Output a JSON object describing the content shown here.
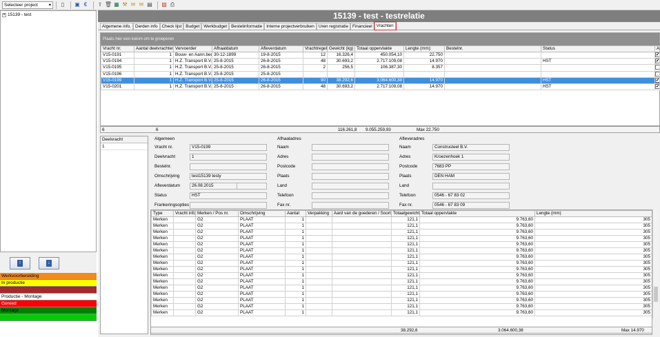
{
  "toolbar": {
    "project_select": "Selecteer project",
    "icons": [
      "new-doc-icon",
      "save-icon",
      "euro-icon",
      "export-icon",
      "trash-icon",
      "excel-icon",
      "tools-icon",
      "mail-icon",
      "email-icon",
      "table-icon",
      "pdf-icon",
      "print-icon"
    ]
  },
  "tree": {
    "items": [
      {
        "label": "15139 - test"
      }
    ]
  },
  "legend": [
    {
      "label": "Werkvoorbereiding",
      "color": "#f28a1c"
    },
    {
      "label": "In productie",
      "color": "#ffff00"
    },
    {
      "label": "",
      "color": "#a52a2a"
    },
    {
      "label": "Productie - Montage",
      "color": "#ffffff"
    },
    {
      "label": "Gereed",
      "color": "#ff0000"
    },
    {
      "label": "Montage",
      "color": "#008000"
    },
    {
      "label": "",
      "color": "#00cc00"
    }
  ],
  "header": {
    "title": "15139 - test - testrelatie"
  },
  "tabs": [
    {
      "label": "Algemene info."
    },
    {
      "label": "Derden info"
    },
    {
      "label": "Check lijst"
    },
    {
      "label": "Budget"
    },
    {
      "label": "Werkbudget"
    },
    {
      "label": "Bestelinformatie"
    },
    {
      "label": "Interne projectverbruiken"
    },
    {
      "label": "Uren registratie"
    },
    {
      "label": "Financieel"
    },
    {
      "label": "Vrachten",
      "active": true
    }
  ],
  "vrachten": {
    "group_hint": "Plaats hier een kolom om te groeperen",
    "columns": [
      "Vracht nr.",
      "Aantal deelvrachten",
      "Vervoerder",
      "Afhaaldatum",
      "Afleverdatum",
      "Vrachtregels",
      "Gewicht (kg)",
      "Totaal oppervlakte",
      "Lengte (mm):",
      "Bestelnr.",
      "Status",
      "Act"
    ],
    "rows": [
      {
        "nr": "V15-0191",
        "deel": "1",
        "vervoerder": "Bouw- en Aann.bedr.",
        "afhaal": "30-12-1899",
        "aflever": "19-8-2015",
        "regels": "12",
        "gewicht": "16.326,4",
        "opp": "450.054,10",
        "lengte": "22.750",
        "bestel": "",
        "status": "",
        "act": true,
        "sel": false
      },
      {
        "nr": "V15-0194",
        "deel": "1",
        "vervoerder": "H.Z. Transport B.V.",
        "afhaal": "25-8-2015",
        "aflever": "26-8-2015",
        "regels": "48",
        "gewicht": "30.693,2",
        "opp": "2.717.109,08",
        "lengte": "14.970",
        "bestel": "",
        "status": "HST",
        "act": true,
        "sel": false
      },
      {
        "nr": "V15-0195",
        "deel": "1",
        "vervoerder": "H.Z. Transport B.V.",
        "afhaal": "25-8-2015",
        "aflever": "26-8-2015",
        "regels": "2",
        "gewicht": "256,5",
        "opp": "106.387,30",
        "lengte": "8.357",
        "bestel": "",
        "status": "",
        "act": false,
        "sel": false
      },
      {
        "nr": "V15-0196",
        "deel": "1",
        "vervoerder": "H.Z. Transport B.V.",
        "afhaal": "25-8-2015",
        "aflever": "25-8-2015",
        "regels": "",
        "gewicht": "",
        "opp": "",
        "lengte": "",
        "bestel": "",
        "status": "",
        "act": false,
        "sel": false
      },
      {
        "nr": "V15-0199",
        "deel": "1",
        "vervoerder": "H.Z. Transport B.V.",
        "afhaal": "25-8-2015",
        "aflever": "26-8-2015",
        "regels": "90",
        "gewicht": "38.292,6",
        "opp": "3.064.600,38",
        "lengte": "14.970",
        "bestel": "",
        "status": "HST",
        "act": true,
        "sel": true
      },
      {
        "nr": "V15-0201",
        "deel": "1",
        "vervoerder": "H.Z. Transport B.V.",
        "afhaal": "25-8-2015",
        "aflever": "26-8-2015",
        "regels": "48",
        "gewicht": "30.693,2",
        "opp": "2.717.109,08",
        "lengte": "14.970",
        "bestel": "",
        "status": "HST",
        "act": true,
        "sel": false
      }
    ],
    "footer": {
      "count": "6",
      "deel": "6",
      "gewicht": "116.261,8",
      "opp": "9.055.259,93",
      "lengte": "Max 22.750"
    }
  },
  "deelvracht": {
    "header": "Deelvracht",
    "rows": [
      "1"
    ]
  },
  "algemeen": {
    "title": "Algemeen",
    "vracht_nr_label": "Vracht nr.",
    "vracht_nr": "V15-0199",
    "deelvracht_label": "Deelvracht",
    "deelvracht": "1",
    "bestelnr_label": "Bestelnr.",
    "bestelnr": "",
    "omschrijving_label": "Omschrijving",
    "omschrijving": "test15139 testy",
    "afleverdatum_label": "Afleverdatum",
    "afleverdatum": "26.08.2015",
    "status_label": "Status",
    "status": "HST",
    "frankering_label": "Frankeringsopties",
    "frankering": ""
  },
  "afhaaladres": {
    "title": "Afhaaladres",
    "naam_label": "Naam",
    "naam": "",
    "adres_label": "Adres",
    "adres": "",
    "postcode_label": "Postcode",
    "postcode": "",
    "plaats_label": "Plaats",
    "plaats": "",
    "land_label": "Land",
    "land": "",
    "telefoon_label": "Telefoon",
    "telefoon": "",
    "fax_label": "Fax nr.",
    "fax": ""
  },
  "afleveradres": {
    "title": "Afleveradres",
    "naam_label": "Naam",
    "naam": "Construsteel  B.V.",
    "adres_label": "Adres",
    "adres": "Kroezenhoek 1",
    "postcode_label": "Postcode",
    "postcode": "7683 PP",
    "plaats_label": "Plaats",
    "plaats": "DEN HAM",
    "land_label": "Land",
    "land": "",
    "telefoon_label": "Telefoon",
    "telefoon": "0546 - 67 83 02",
    "fax_label": "Fax nr.",
    "fax": "0546 - 67 83 09"
  },
  "details": {
    "columns": [
      "Type",
      "Vracht info",
      "Merken / Pos nr.",
      "Omschrijving",
      "Aantal",
      "Verpakking",
      "Aard van de goederen / Soort",
      "Totaalgewicht",
      "Totaal oppervlakte",
      "Lengte (mm)"
    ],
    "rows": [
      [
        "Merken",
        "",
        "G2",
        "PLAAT",
        "1",
        "",
        "",
        "121,1",
        "9.763,60",
        "305"
      ],
      [
        "Merken",
        "",
        "G2",
        "PLAAT",
        "1",
        "",
        "",
        "121,1",
        "9.763,60",
        "305"
      ],
      [
        "Merken",
        "",
        "G2",
        "PLAAT",
        "1",
        "",
        "",
        "121,1",
        "9.763,60",
        "305"
      ],
      [
        "Merken",
        "",
        "G2",
        "PLAAT",
        "1",
        "",
        "",
        "121,1",
        "9.763,60",
        "305"
      ],
      [
        "Merken",
        "",
        "G2",
        "PLAAT",
        "1",
        "",
        "",
        "121,1",
        "9.763,60",
        "305"
      ],
      [
        "Merken",
        "",
        "G2",
        "PLAAT",
        "1",
        "",
        "",
        "121,1",
        "9.763,60",
        "305"
      ],
      [
        "Merken",
        "",
        "G2",
        "PLAAT",
        "1",
        "",
        "",
        "121,1",
        "9.763,60",
        "305"
      ],
      [
        "Merken",
        "",
        "G2",
        "PLAAT",
        "1",
        "",
        "",
        "121,1",
        "9.763,60",
        "305"
      ],
      [
        "Merken",
        "",
        "G2",
        "PLAAT",
        "1",
        "",
        "",
        "121,1",
        "9.763,60",
        "305"
      ],
      [
        "Merken",
        "",
        "G2",
        "PLAAT",
        "1",
        "",
        "",
        "121,1",
        "9.763,60",
        "305"
      ],
      [
        "Merken",
        "",
        "G2",
        "PLAAT",
        "1",
        "",
        "",
        "121,1",
        "9.763,60",
        "305"
      ],
      [
        "Merken",
        "",
        "G2",
        "PLAAT",
        "1",
        "",
        "",
        "121,1",
        "9.763,60",
        "305"
      ],
      [
        "Merken",
        "",
        "G2",
        "PLAAT",
        "1",
        "",
        "",
        "121,1",
        "9.763,60",
        "305"
      ],
      [
        "Merken",
        "",
        "G2",
        "PLAAT",
        "1",
        "",
        "",
        "121,1",
        "9.763,60",
        "305"
      ],
      [
        "Merken",
        "",
        "G2",
        "PLAAT",
        "1",
        "",
        "",
        "121,1",
        "9.763,60",
        "305"
      ],
      [
        "Merken",
        "",
        "G2",
        "PLAAT",
        "1",
        "",
        "",
        "121,1",
        "9.763,60",
        "305"
      ]
    ],
    "footer": {
      "gewicht": "38.292,6",
      "opp": "3.064.600,38",
      "lengte": "Max 14.970"
    }
  }
}
